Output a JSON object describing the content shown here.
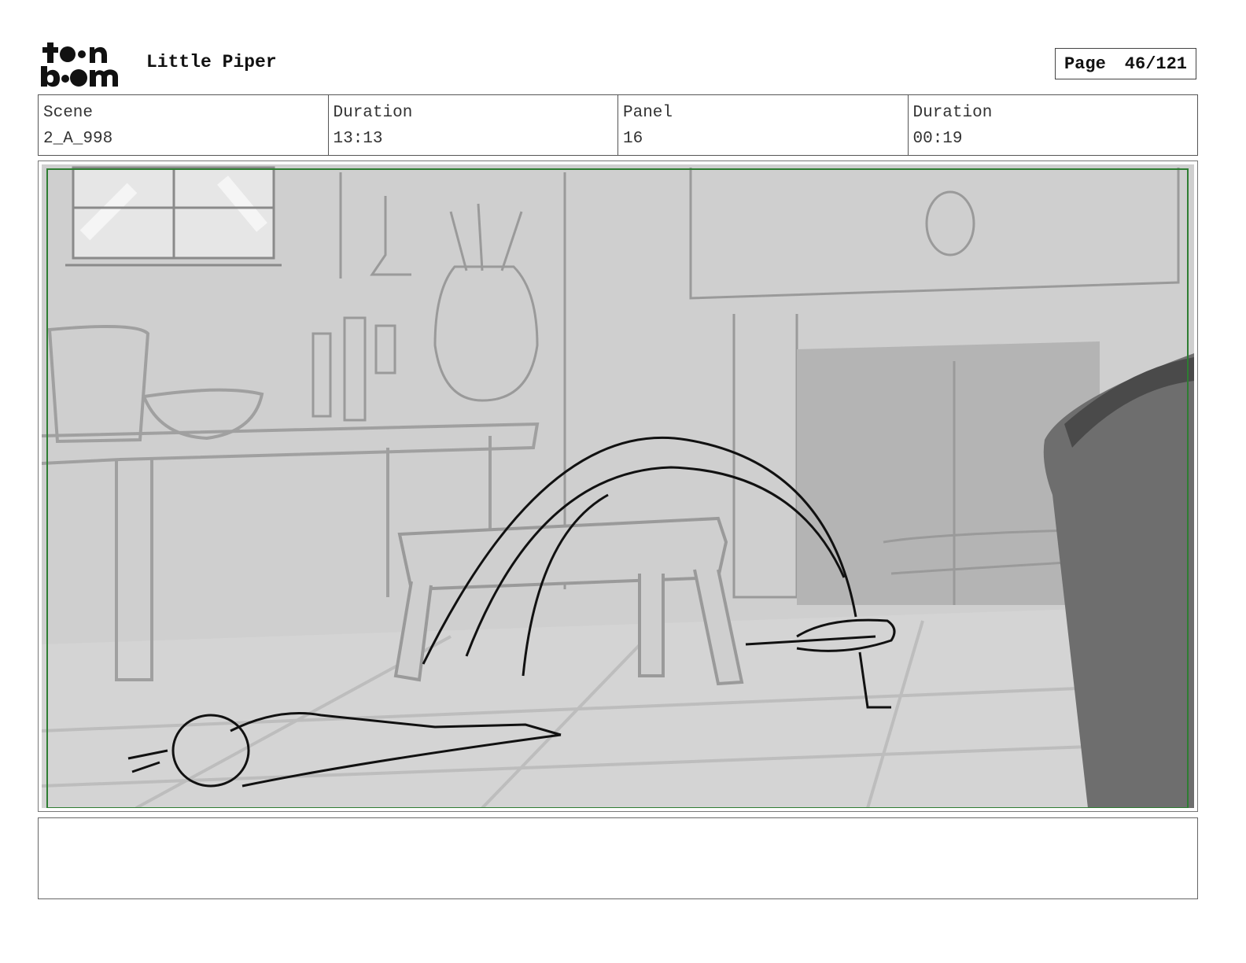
{
  "header": {
    "logo_text": "toonboom",
    "project_title": "Little Piper",
    "page_label": "Page",
    "page_value": "46/121"
  },
  "info": {
    "scene_label": "Scene",
    "scene_value": "2_A_998",
    "duration_label": "Duration",
    "duration_value": "13:13",
    "panel_label": "Panel",
    "panel_value": "16",
    "panel_duration_label": "Duration",
    "panel_duration_value": "00:19"
  },
  "panel_image": {
    "description_icon": "storyboard-sketch-image",
    "safe_frame_color": "#2e7d32"
  },
  "notes": {
    "text": ""
  }
}
